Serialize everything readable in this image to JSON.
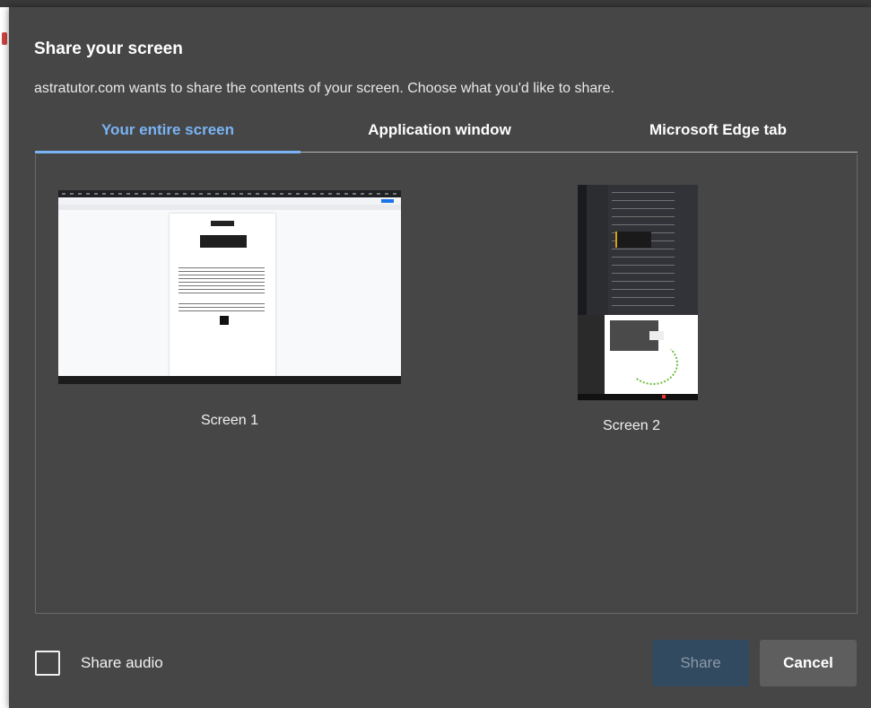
{
  "dialog": {
    "title": "Share your screen",
    "description": "astratutor.com wants to share the contents of your screen. Choose what you'd like to share."
  },
  "tabs": [
    {
      "label": "Your entire screen",
      "active": true
    },
    {
      "label": "Application window",
      "active": false
    },
    {
      "label": "Microsoft Edge tab",
      "active": false
    }
  ],
  "sources": [
    {
      "label": "Screen 1"
    },
    {
      "label": "Screen 2"
    }
  ],
  "footer": {
    "share_audio_label": "Share audio",
    "share_audio_checked": false,
    "share_button": "Share",
    "share_button_enabled": false,
    "cancel_button": "Cancel"
  },
  "colors": {
    "dialog_bg": "#464646",
    "accent": "#7ab4f5",
    "share_disabled": "#324a5f",
    "cancel_bg": "#5e5e5e"
  }
}
